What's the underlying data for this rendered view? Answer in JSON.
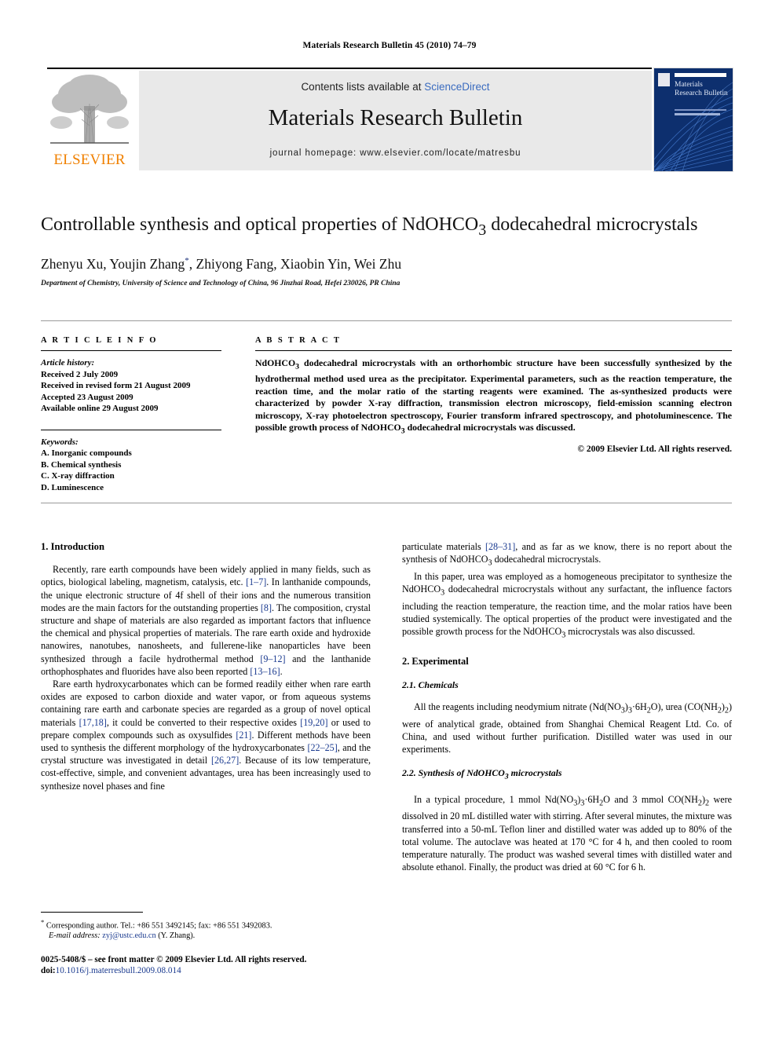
{
  "running_head": "Materials Research Bulletin 45 (2010) 74–79",
  "masthead": {
    "contents_prefix": "Contents lists available at ",
    "sciencedirect": "ScienceDirect",
    "journal_title": "Materials Research Bulletin",
    "homepage": "journal homepage: www.elsevier.com/locate/matresbu",
    "publisher_logo_text": "ELSEVIER",
    "cover_title": "Materials Research Bulletin",
    "link_color": "#3a6bbf",
    "band_color": "#e9e9e9",
    "elsevier_orange": "#F08000",
    "cover_blue": "#0d2f6e"
  },
  "article": {
    "title": "Controllable synthesis and optical properties of NdOHCO3 dodecahedral microcrystals",
    "title_part1": "Controllable synthesis and optical properties of NdOHCO",
    "title_sub": "3",
    "title_part2": " dodecahedral microcrystals",
    "authors_part1": "Zhenyu Xu, Youjin Zhang",
    "authors_star": "*",
    "authors_part2": ", Zhiyong Fang, Xiaobin Yin, Wei Zhu",
    "affiliation": "Department of Chemistry, University of Science and Technology of China, 96 Jinzhai Road, Hefei 230026, PR China"
  },
  "info": {
    "heading": "A R T I C L E   I N F O",
    "history_label": "Article history:",
    "history": [
      "Received 2 July 2009",
      "Received in revised form 21 August 2009",
      "Accepted 23 August 2009",
      "Available online 29 August 2009"
    ],
    "keywords_label": "Keywords:",
    "keywords": [
      "A. Inorganic compounds",
      "B. Chemical synthesis",
      "C. X-ray diffraction",
      "D. Luminescence"
    ]
  },
  "abstract": {
    "heading": "A B S T R A C T",
    "text_part1": "NdOHCO",
    "sub1": "3",
    "text_part2": " dodecahedral microcrystals with an orthorhombic structure have been successfully synthesized by the hydrothermal method used urea as the precipitator. Experimental parameters, such as the reaction temperature, the reaction time, and the molar ratio of the starting reagents were examined. The as-synthesized products were characterized by powder X-ray diffraction, transmission electron microscopy, field-emission scanning electron microscopy, X-ray photoelectron spectroscopy, Fourier transform infrared spectroscopy, and photoluminescence. The possible growth process of NdOHCO",
    "sub2": "3",
    "text_part3": " dodecahedral microcrystals was discussed.",
    "copyright": "© 2009 Elsevier Ltd. All rights reserved."
  },
  "body": {
    "intro_heading": "1. Introduction",
    "intro_p1_a": "Recently, rare earth compounds have been widely applied in many fields, such as optics, biological labeling, magnetism, catalysis, etc. ",
    "intro_p1_ref1": "[1–7]",
    "intro_p1_b": ". In lanthanide compounds, the unique electronic structure of 4f shell of their ions and the numerous transition modes are the main factors for the outstanding properties ",
    "intro_p1_ref2": "[8]",
    "intro_p1_c": ". The composition, crystal structure and shape of materials are also regarded as important factors that influence the chemical and physical properties of materials. The rare earth oxide and hydroxide nanowires, nanotubes, nanosheets, and fullerene-like nanoparticles have been synthesized through a facile hydrothermal method ",
    "intro_p1_ref3": "[9–12]",
    "intro_p1_d": " and the lanthanide orthophosphates and fluorides have also been reported ",
    "intro_p1_ref4": "[13–16]",
    "intro_p1_e": ".",
    "intro_p2_a": "Rare earth hydroxycarbonates which can be formed readily either when rare earth oxides are exposed to carbon dioxide and water vapor, or from aqueous systems containing rare earth and carbonate species are regarded as a group of novel optical materials ",
    "intro_p2_ref1": "[17,18]",
    "intro_p2_b": ", it could be converted to their respective oxides ",
    "intro_p2_ref2": "[19,20]",
    "intro_p2_c": " or used to prepare complex compounds such as oxysulfides ",
    "intro_p2_ref3": "[21]",
    "intro_p2_d": ". Different methods have been used to synthesis the different morphology of the hydroxycarbonates ",
    "intro_p2_ref4": "[22–25]",
    "intro_p2_e": ", and the crystal structure was investigated in detail ",
    "intro_p2_ref5": "[26,27]",
    "intro_p2_f": ". Because of its low temperature, cost-effective, simple, and convenient advantages, urea has been increasingly used to synthesize novel phases and fine",
    "right_p1_a": "particulate materials ",
    "right_p1_ref1": "[28–31]",
    "right_p1_b": ", and as far as we know, there is no report about the synthesis of NdOHCO",
    "right_p1_sub": "3",
    "right_p1_c": " dodecahedral microcrystals.",
    "right_p2_a": "In this paper, urea was employed as a homogeneous precipitator to synthesize the NdOHCO",
    "right_p2_sub1": "3",
    "right_p2_b": " dodecahedral microcrystals without any surfactant, the influence factors including the reaction temperature, the reaction time, and the molar ratios have been studied systemically. The optical properties of the product were investigated and the possible growth process for the NdOHCO",
    "right_p2_sub2": "3",
    "right_p2_c": " microcrystals was also discussed.",
    "exp_heading": "2. Experimental",
    "chem_heading": "2.1. Chemicals",
    "chem_p_a": "All the reagents including neodymium nitrate (Nd(NO",
    "chem_sub1": "3",
    "chem_p_b": ")",
    "chem_sub2": "3",
    "chem_p_c": "·6H",
    "chem_sub3": "2",
    "chem_p_d": "O), urea (CO(NH",
    "chem_sub4": "2",
    "chem_p_e": ")",
    "chem_sub5": "2",
    "chem_p_f": ") were of analytical grade, obtained from Shanghai Chemical Reagent Ltd. Co. of China, and used without further purification. Distilled water was used in our experiments.",
    "synth_heading_a": "2.2. Synthesis of NdOHCO",
    "synth_heading_sub": "3",
    "synth_heading_b": " microcrystals",
    "synth_p_a": "In a typical procedure, 1 mmol Nd(NO",
    "synth_sub1": "3",
    "synth_p_b": ")",
    "synth_sub2": "3",
    "synth_p_c": "·6H",
    "synth_sub3": "2",
    "synth_p_d": "O and 3 mmol CO(NH",
    "synth_sub4": "2",
    "synth_p_e": ")",
    "synth_sub5": "2",
    "synth_p_f": " were dissolved in 20 mL distilled water with stirring. After several minutes, the mixture was transferred into a 50-mL Teflon liner and distilled water was added up to 80% of the total volume. The autoclave was heated at 170 °C for 4 h, and then cooled to room temperature naturally. The product was washed several times with distilled water and absolute ethanol. Finally, the product was dried at 60 °C for 6 h."
  },
  "footnote": {
    "star": "*",
    "corresponding": "Corresponding author. Tel.: +86 551 3492145; fax: +86 551 3492083.",
    "email_label": "E-mail address:",
    "email": "zyj@ustc.edu.cn",
    "email_suffix": "(Y. Zhang).",
    "imprint": "0025-5408/$ – see front matter © 2009 Elsevier Ltd. All rights reserved.",
    "doi_label": "doi:",
    "doi": "10.1016/j.materresbull.2009.08.014"
  }
}
